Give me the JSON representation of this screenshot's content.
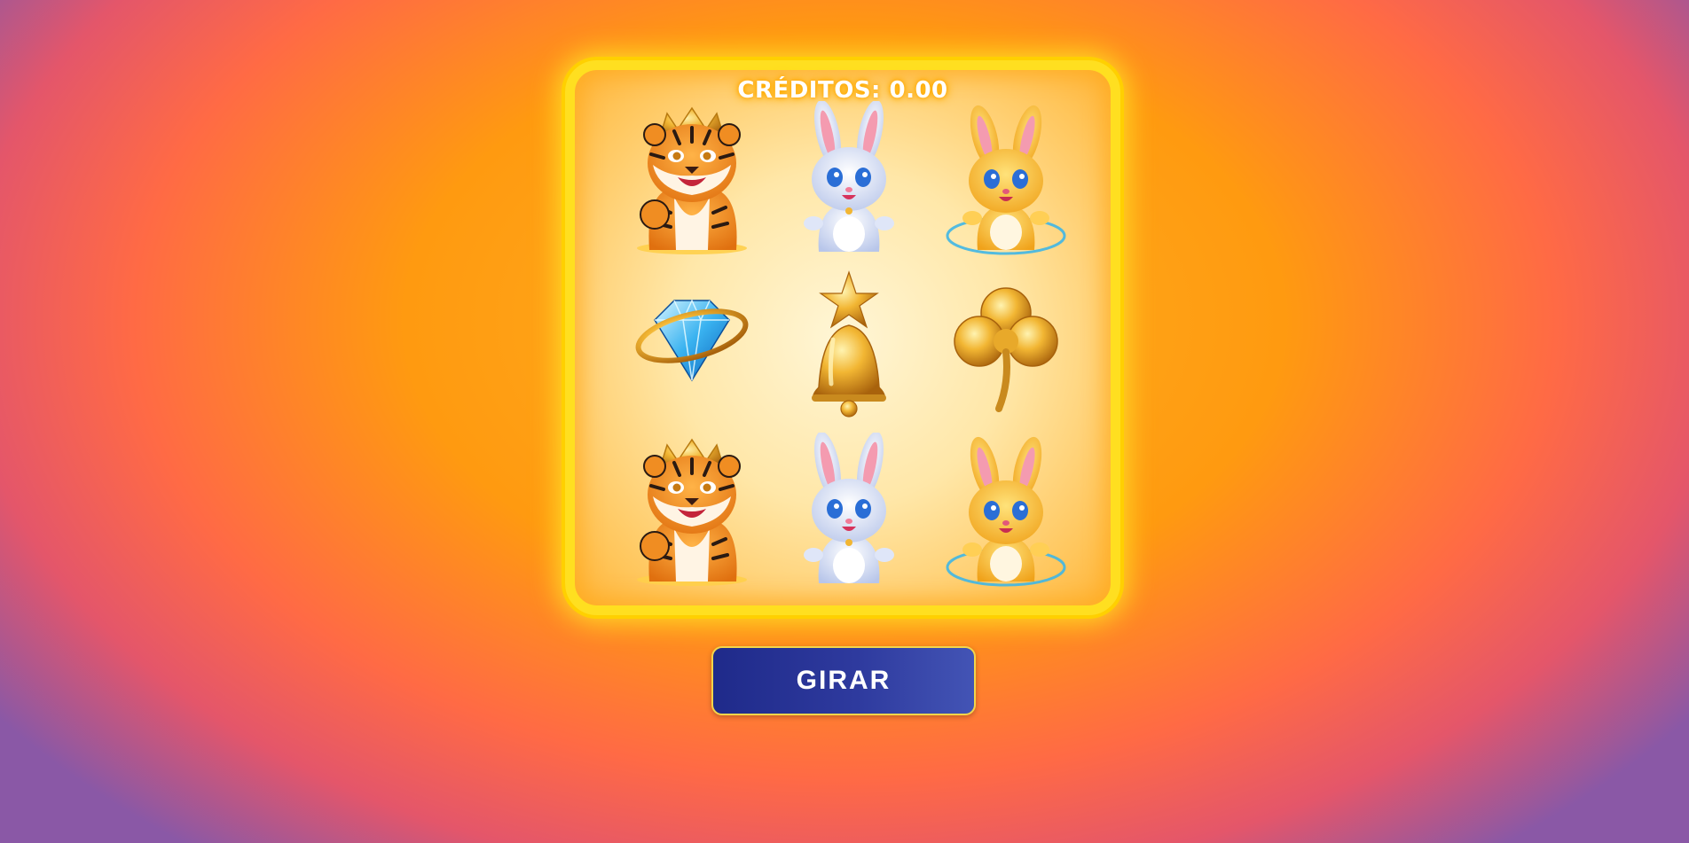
{
  "machine": {
    "credits_text": "CRÉDITOS: 0.00"
  },
  "reels": [
    [
      "tiger-icon",
      "rabbit-icon",
      "golden-rabbit-icon"
    ],
    [
      "diamond-icon",
      "bell-icon",
      "clover-icon"
    ],
    [
      "tiger-icon",
      "rabbit-icon",
      "golden-rabbit-icon"
    ]
  ],
  "spin_button": {
    "label": "GIRAR"
  },
  "colors": {
    "frame": "#ffdf20",
    "button": "#2e3a9e",
    "button_border": "#f3d54a"
  }
}
